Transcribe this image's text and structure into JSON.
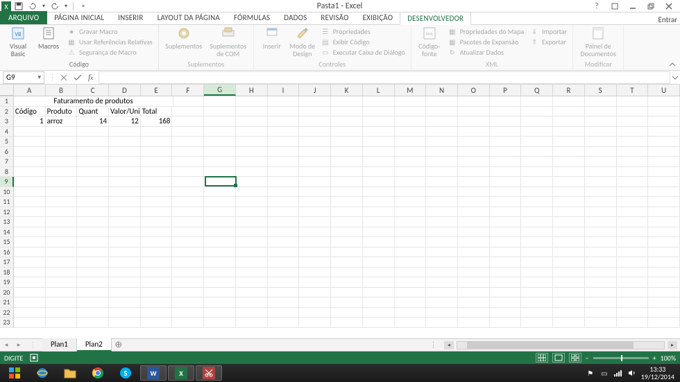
{
  "title": "Pasta1 - Excel",
  "qat": {
    "undo_dd": "▾"
  },
  "signin": "Entrar",
  "tabs": {
    "file": "ARQUIVO",
    "items": [
      "PÁGINA INICIAL",
      "INSERIR",
      "LAYOUT DA PÁGINA",
      "FÓRMULAS",
      "DADOS",
      "REVISÃO",
      "EXIBIÇÃO",
      "DESENVOLVEDOR"
    ],
    "active": "DESENVOLVEDOR"
  },
  "ribbon": {
    "code": {
      "vb": "Visual\nBasic",
      "macros": "Macros",
      "rec": "Gravar Macro",
      "relref": "Usar Referências Relativas",
      "sec": "Segurança de Macro",
      "group": "Código"
    },
    "addins": {
      "supl": "Suplementos",
      "com": "Suplementos\nde COM",
      "group": "Suplementos"
    },
    "controls": {
      "insert": "Inserir",
      "design": "Modo de\nDesign",
      "props": "Propriedades",
      "viewcode": "Exibir Código",
      "rundlg": "Executar Caixa de Diálogo",
      "group": "Controles"
    },
    "xml": {
      "source": "Código-\nfonte",
      "mapprops": "Propriedades do Mapa",
      "expand": "Pacotes de Expansão",
      "refresh": "Atualizar Dados",
      "import": "Importar",
      "export": "Exportar",
      "group": "XML"
    },
    "modify": {
      "panel": "Painel de\nDocumentos",
      "group": "Modificar"
    }
  },
  "namebox": "G9",
  "fx_value": "",
  "columns": [
    "A",
    "B",
    "C",
    "D",
    "E",
    "F",
    "G",
    "H",
    "I",
    "J",
    "K",
    "L",
    "M",
    "N",
    "O",
    "P",
    "Q",
    "R",
    "S",
    "T",
    "U"
  ],
  "sel_col_idx": 6,
  "sel_row_idx": 8,
  "merged_title": "Faturamento de produtos",
  "headers": [
    "Código",
    "Produto",
    "Quant",
    "Valor/Uni",
    "Total"
  ],
  "data_row": {
    "codigo": "1",
    "produto": "arroz",
    "quant": "14",
    "valor": "12",
    "total": "168"
  },
  "row_count": 23,
  "sheets": {
    "items": [
      "Plan1",
      "Plan2"
    ],
    "active": "Plan2"
  },
  "status": {
    "mode": "DIGITE",
    "zoom": "100%"
  },
  "clock": {
    "time": "13:33",
    "date": "19/12/2014"
  },
  "colors": {
    "accent": "#217346"
  }
}
